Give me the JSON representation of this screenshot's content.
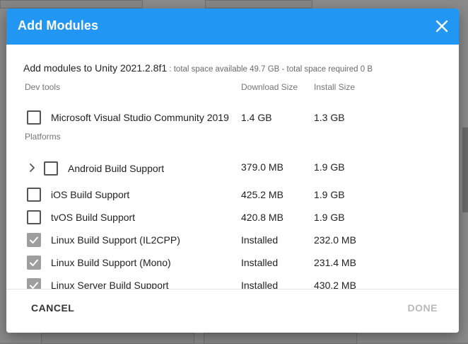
{
  "dialog": {
    "title": "Add Modules",
    "summary_main": "Add modules to Unity 2021.2.8f1",
    "summary_sub": " : total space available 49.7 GB - total space required 0 B"
  },
  "columns": {
    "download": "Download Size",
    "install": "Install Size"
  },
  "sections": {
    "dev_tools": "Dev tools",
    "platforms": "Platforms"
  },
  "modules": [
    {
      "name": "Microsoft Visual Studio Community 2019",
      "download": "1.4 GB",
      "install": "1.3 GB",
      "checked": false
    },
    {
      "name": "Android Build Support",
      "download": "379.0 MB",
      "install": "1.9 GB",
      "checked": false,
      "expandable": true
    },
    {
      "name": "iOS Build Support",
      "download": "425.2 MB",
      "install": "1.9 GB",
      "checked": false
    },
    {
      "name": "tvOS Build Support",
      "download": "420.8 MB",
      "install": "1.9 GB",
      "checked": false
    },
    {
      "name": "Linux Build Support (IL2CPP)",
      "download": "Installed",
      "install": "232.0 MB",
      "checked": true
    },
    {
      "name": "Linux Build Support (Mono)",
      "download": "Installed",
      "install": "231.4 MB",
      "checked": true
    },
    {
      "name": "Linux Server Build Support",
      "download": "Installed",
      "install": "430.2 MB",
      "checked": true
    }
  ],
  "footer": {
    "cancel_label": "CANCEL",
    "done_label": "DONE"
  },
  "icons": {
    "close": "close-icon",
    "expand": "chevron-right-icon",
    "check": "checkmark-icon"
  },
  "colors": {
    "header": "#2196f3",
    "checked_box": "#9e9e9e",
    "disabled_text": "#b8b8b8"
  }
}
